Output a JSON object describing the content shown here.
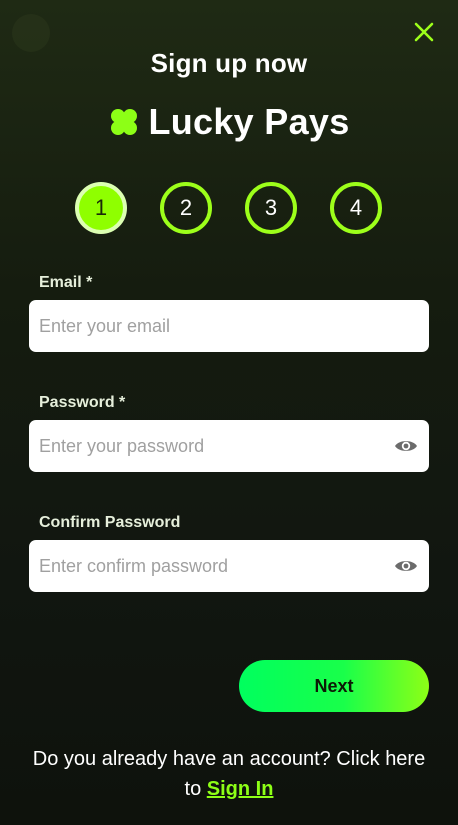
{
  "header": {
    "title": "Sign up now",
    "brand_name": "Lucky Pays"
  },
  "steps": [
    "1",
    "2",
    "3",
    "4"
  ],
  "form": {
    "email_label": "Email *",
    "email_placeholder": "Enter your email",
    "password_label": "Password *",
    "password_placeholder": "Enter your password",
    "confirm_label": "Confirm Password",
    "confirm_placeholder": "Enter confirm password",
    "next_label": "Next"
  },
  "footer": {
    "prompt": "Do you already have an account? Click here to",
    "signin_label": "Sign In"
  },
  "icons": {
    "close": "close-icon",
    "logo": "clover-logo-icon",
    "eye": "eye-icon"
  },
  "colors": {
    "accent": "#8dff16",
    "button_start": "#00ff5e",
    "background": "#151c0f"
  }
}
